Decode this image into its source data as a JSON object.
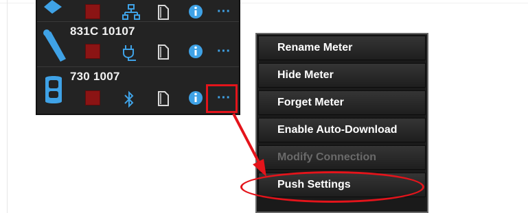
{
  "meters": [
    {
      "name": "",
      "device_icon": "meter-device-icon",
      "connection_icon": "network-icon"
    },
    {
      "name": "831C 10107",
      "device_icon": "sound-level-meter-icon",
      "connection_icon": "usb-icon"
    },
    {
      "name": "730 1007",
      "device_icon": "dosimeter-icon",
      "connection_icon": "bluetooth-icon"
    }
  ],
  "more_label": "···",
  "context_menu": {
    "items": [
      {
        "label": "Rename Meter",
        "enabled": true
      },
      {
        "label": "Hide Meter",
        "enabled": true
      },
      {
        "label": "Forget Meter",
        "enabled": true
      },
      {
        "label": "Enable Auto-Download",
        "enabled": true
      },
      {
        "label": "Modify Connection",
        "enabled": false
      },
      {
        "label": "Push Settings",
        "enabled": true
      }
    ]
  },
  "colors": {
    "panel_bg": "#232323",
    "stop_red": "#8b1414",
    "accent_blue": "#3fa2e6",
    "annotation_red": "#e4141b"
  }
}
